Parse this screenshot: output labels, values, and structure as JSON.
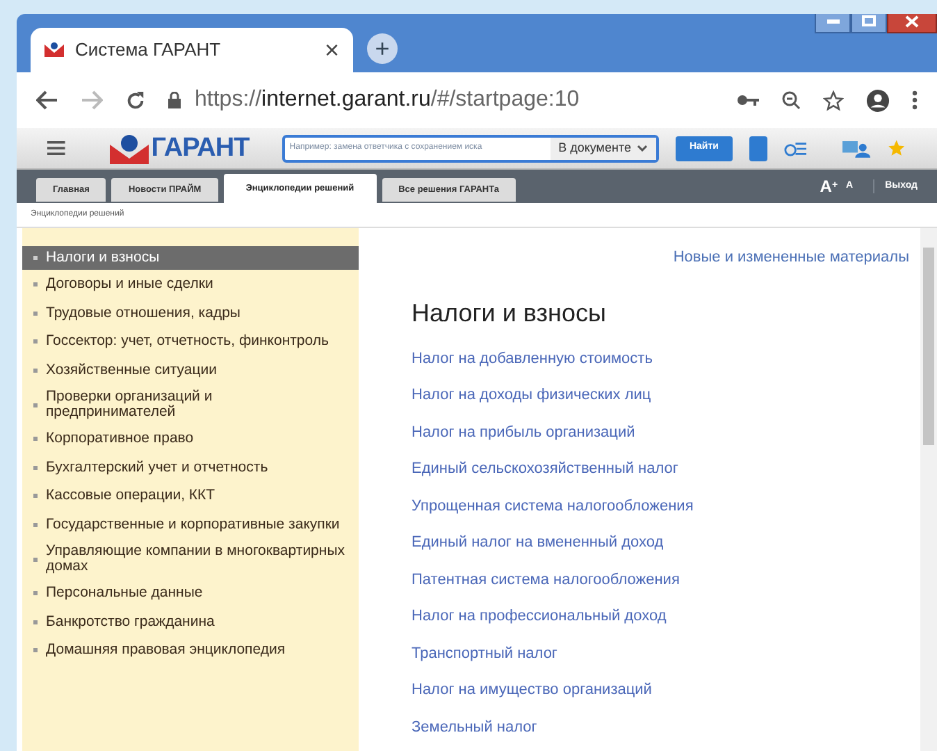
{
  "browser_tab": {
    "title": "Система ГАРАНТ",
    "close": "×",
    "new_tab": "+"
  },
  "address_bar": {
    "url_prefix": "https://",
    "url_host": "internet.garant.ru",
    "url_path": "/#/startpage:10"
  },
  "toolbar": {
    "logo": "ГАРАНТ",
    "search_placeholder": "Например: замена ответчика с сохранением иска",
    "scope": "В документе",
    "find_button": "Найти"
  },
  "nav_tabs": [
    {
      "label": "Главная",
      "selected": false
    },
    {
      "label": "Новости ПРАЙМ",
      "selected": false
    },
    {
      "label": "Энциклопедии решений",
      "selected": true
    },
    {
      "label": "Все решения ГАРАНТа",
      "selected": false
    }
  ],
  "font_controls": {
    "increase": "A",
    "increase_mark": "+",
    "decrease": "A"
  },
  "exit": "Выход",
  "breadcrumb": "Энциклопедии решений",
  "sidebar": {
    "items": [
      {
        "label": "Налоги и взносы",
        "selected": true
      },
      {
        "label": "Договоры и иные сделки",
        "selected": false
      },
      {
        "label": "Трудовые отношения, кадры",
        "selected": false
      },
      {
        "label": "Госсектор: учет, отчетность, финконтроль",
        "selected": false
      },
      {
        "label": "Хозяйственные ситуации",
        "selected": false
      },
      {
        "label": "Проверки организаций и предпринимателей",
        "selected": false
      },
      {
        "label": "Корпоративное право",
        "selected": false
      },
      {
        "label": "Бухгалтерский учет и отчетность",
        "selected": false
      },
      {
        "label": "Кассовые операции, ККТ",
        "selected": false
      },
      {
        "label": "Государственные и корпоративные закупки",
        "selected": false
      },
      {
        "label": "Управляющие компании в многоквартирных домах",
        "selected": false
      },
      {
        "label": "Персональные данные",
        "selected": false
      },
      {
        "label": "Банкротство гражданина",
        "selected": false
      },
      {
        "label": "Домашняя правовая энциклопедия",
        "selected": false
      }
    ]
  },
  "content": {
    "top_link": "Новые и измененные материалы",
    "heading": "Налоги и взносы",
    "links": [
      "Налог на добавленную стоимость",
      "Налог на доходы физических лиц",
      "Налог на прибыль организаций",
      "Единый сельскохозяйственный налог",
      "Упрощенная система налогообложения",
      "Единый налог на вмененный доход",
      "Патентная система налогообложения",
      "Налог на профессиональный доход",
      "Транспортный налог",
      "Налог на имущество организаций",
      "Земельный налог"
    ]
  }
}
